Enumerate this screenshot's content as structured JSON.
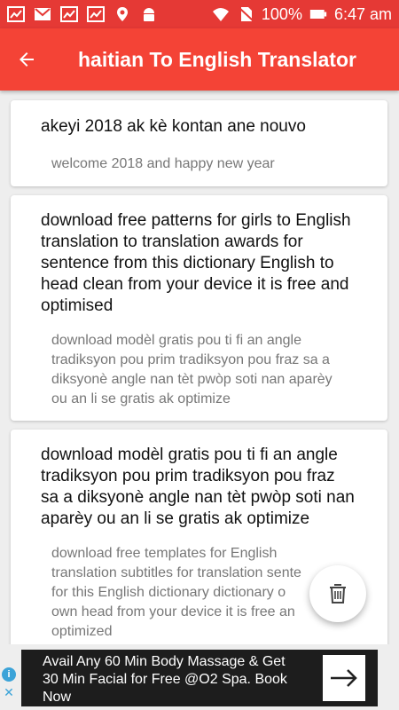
{
  "status_bar": {
    "battery": "100%",
    "time": "6:47 am"
  },
  "app_bar": {
    "title": "haitian To English Translator"
  },
  "cards": [
    {
      "source_lines": [
        "akeyi 2018 ak kè kontan ane nouvo"
      ],
      "translation_lines": [
        "welcome 2018 and happy new year"
      ]
    },
    {
      "source_lines": [
        "download free patterns for girls to English",
        "translation to translation awards for",
        "sentence from this dictionary English to",
        "head clean from your device it is free and",
        "optimised"
      ],
      "translation_lines": [
        "download modèl gratis pou ti fi an angle",
        "tradiksyon pou prim tradiksyon pou fraz sa a",
        "diksyonè angle nan tèt pwòp soti nan aparèy",
        "ou an li se gratis ak optimize"
      ]
    },
    {
      "source_lines": [
        "download modèl gratis pou ti fi an angle",
        "tradiksyon pou prim tradiksyon pou fraz",
        "sa a diksyonè angle nan tèt pwòp soti nan",
        "aparèy ou an li se gratis ak optimize"
      ],
      "translation_lines": [
        "download free templates for English",
        "translation subtitles for translation sente",
        "for this English dictionary dictionary o",
        "own head from your device it is free an",
        "optimized"
      ]
    }
  ],
  "ad": {
    "lines": [
      "Avail Any 60 Min Body Massage & Get",
      "30 Min Facial for Free @O2 Spa. Book",
      "Now"
    ],
    "info_glyph": "i",
    "close_glyph": "✕"
  },
  "icons": {
    "back": "arrow-back-icon",
    "delete": "trash-icon",
    "ad_arrow": "arrow-right-icon"
  },
  "colors": {
    "app_bar": "#f44336",
    "status_bar": "#e53935",
    "card_bg": "#ffffff",
    "page_bg": "#eeeeee"
  }
}
